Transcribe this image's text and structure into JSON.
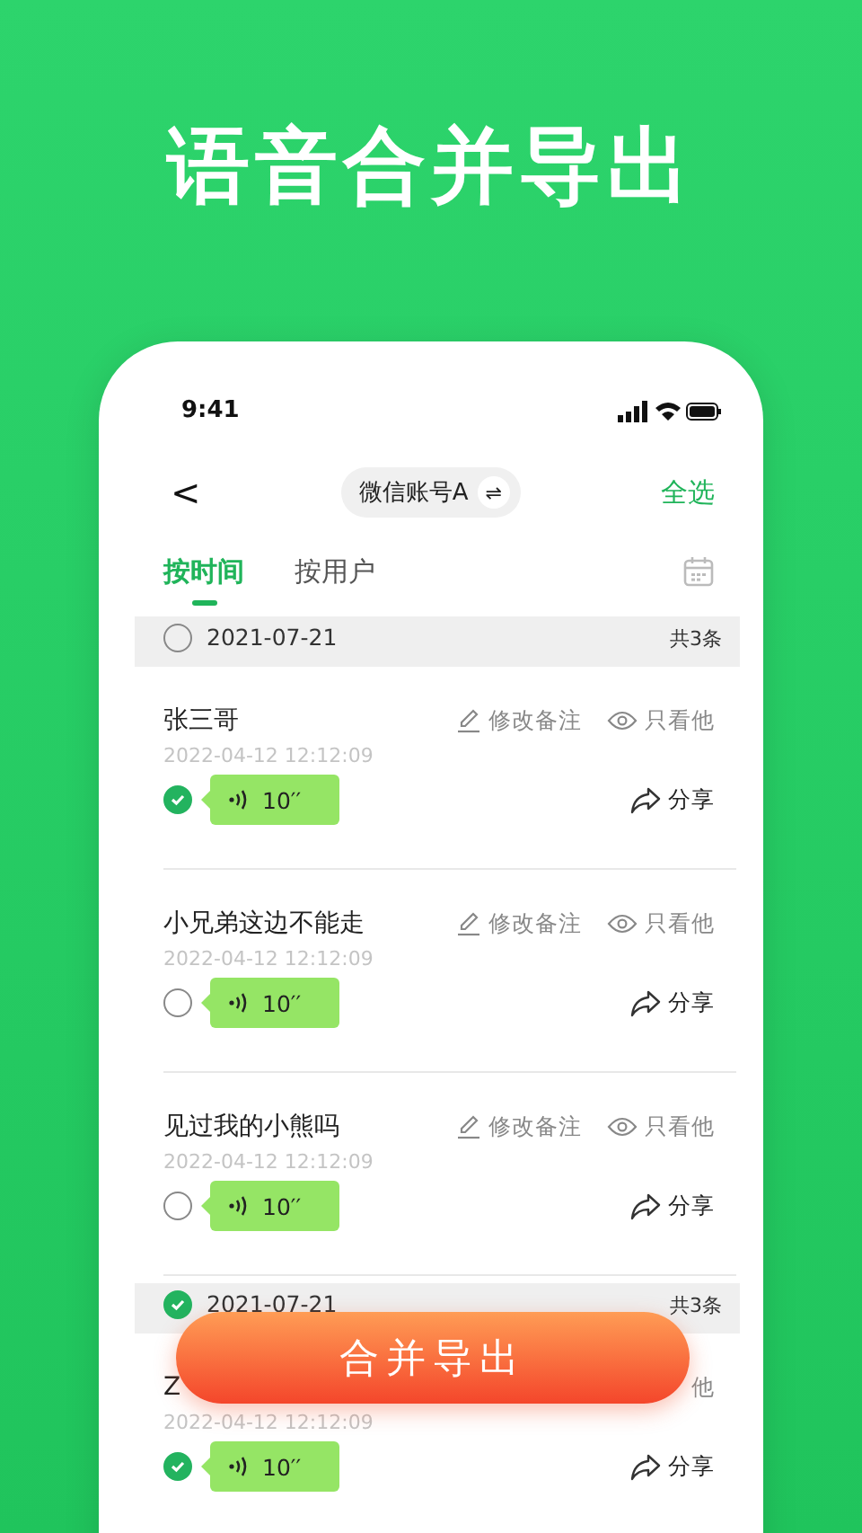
{
  "headline": "语音合并导出",
  "status_bar": {
    "time": "9:41"
  },
  "nav": {
    "back": "<",
    "account": "微信账号A",
    "switch": "⇌",
    "select_all": "全选"
  },
  "tabs": [
    {
      "label": "按时间",
      "selected": true
    },
    {
      "label": "按用户",
      "selected": false
    }
  ],
  "groups": [
    {
      "date": "2021-07-21",
      "count": "共3条",
      "checked": false,
      "items": [
        {
          "name": "张三哥",
          "edit_label": "修改备注",
          "view_label": "只看他",
          "time": "2022-04-12 12:12:09",
          "duration": "10′′",
          "share": "分享",
          "checked": true
        },
        {
          "name": "小兄弟这边不能走",
          "edit_label": "修改备注",
          "view_label": "只看他",
          "time": "2022-04-12 12:12:09",
          "duration": "10′′",
          "share": "分享",
          "checked": false
        },
        {
          "name": "见过我的小熊吗",
          "edit_label": "修改备注",
          "view_label": "只看他",
          "time": "2022-04-12 12:12:09",
          "duration": "10′′",
          "share": "分享",
          "checked": false
        }
      ]
    },
    {
      "date": "2021-07-21",
      "count": "共3条",
      "checked": true,
      "items": [
        {
          "name": "Z",
          "view_label": "他",
          "time": "2022-04-12 12:12:09",
          "duration": "10′′",
          "share": "分享",
          "checked": true
        }
      ]
    }
  ],
  "merge_button": "合并导出"
}
